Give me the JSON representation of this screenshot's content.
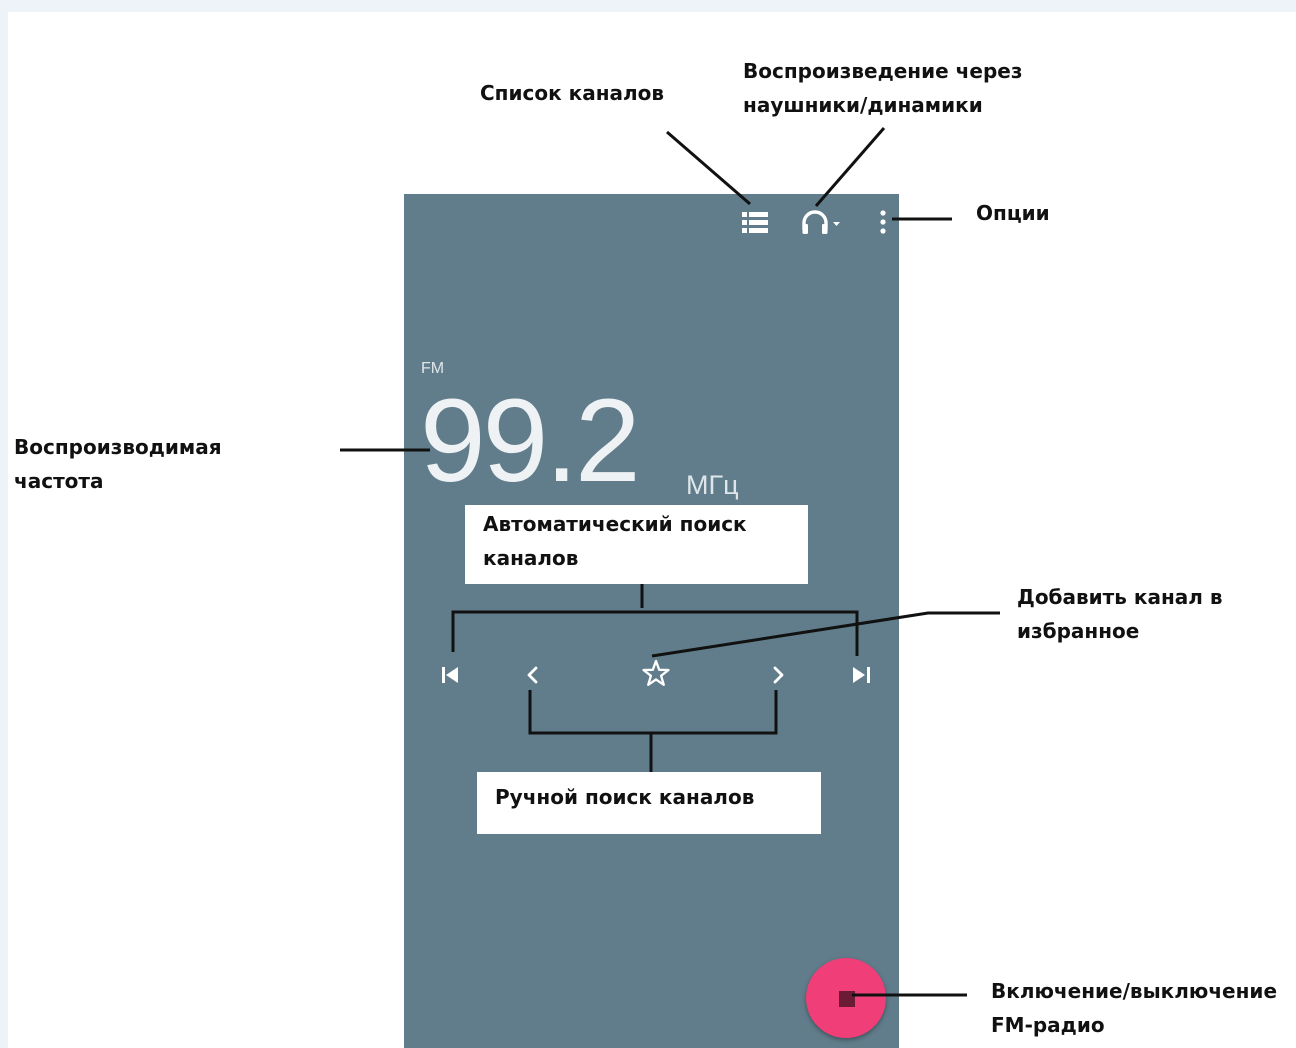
{
  "radio": {
    "band": "FM",
    "frequency": "99.2",
    "unit": "МГц",
    "accent_color": "#f03e78",
    "background_color": "#617d8b"
  },
  "toolbar": {
    "channel_list_icon": "list-icon",
    "audio_output_icon": "headphones-dropdown-icon",
    "options_icon": "more-vert-icon"
  },
  "controls": {
    "seek_prev_icon": "skip-previous-icon",
    "tune_down_icon": "chevron-left-icon",
    "favorite_icon": "star-outline-icon",
    "tune_up_icon": "chevron-right-icon",
    "seek_next_icon": "skip-next-icon",
    "power_icon": "stop-icon"
  },
  "callouts": {
    "channel_list": "Список каналов",
    "audio_output_line1": "Воспроизведение через",
    "audio_output_line2": "наушники/динамики",
    "options": "Опции",
    "frequency_line1": "Воспроизводимая",
    "frequency_line2": "частота",
    "auto_search_line1": "Автоматический поиск",
    "auto_search_line2": "каналов",
    "favorite_line1": "Добавить канал в",
    "favorite_line2": "избранное",
    "manual_search": "Ручной поиск каналов",
    "power_line1": "Включение/выключение",
    "power_line2": "FM-радио"
  }
}
